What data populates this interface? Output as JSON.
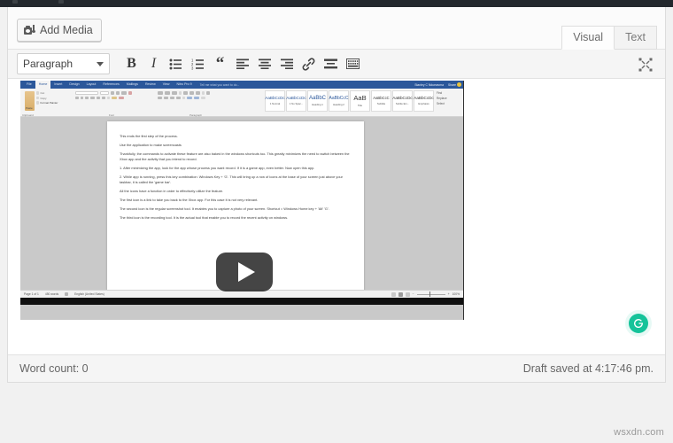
{
  "admin_bar": {
    "present": true
  },
  "media_row": {
    "add_media_label": "Add Media",
    "view_tabs": [
      {
        "label": "Visual",
        "active": true
      },
      {
        "label": "Text",
        "active": false
      }
    ]
  },
  "toolbar": {
    "format_select_value": "Paragraph",
    "buttons": [
      {
        "name": "bold",
        "label": "B"
      },
      {
        "name": "italic",
        "label": "I"
      },
      {
        "name": "bulleted-list",
        "label": ""
      },
      {
        "name": "numbered-list",
        "label": ""
      },
      {
        "name": "blockquote",
        "label": "“"
      },
      {
        "name": "align-left",
        "label": ""
      },
      {
        "name": "align-center",
        "label": ""
      },
      {
        "name": "align-right",
        "label": ""
      },
      {
        "name": "insert-link",
        "label": ""
      },
      {
        "name": "read-more",
        "label": ""
      },
      {
        "name": "toolbar-toggle",
        "label": ""
      }
    ],
    "expand_label": "Distraction-free writing mode"
  },
  "video_embed": {
    "word_app": {
      "ribbon_tabs": [
        "File",
        "Home",
        "Insert",
        "Design",
        "Layout",
        "References",
        "Mailings",
        "Review",
        "View",
        "Nitro Pro 9"
      ],
      "active_tab": "Home",
      "tell_me": "Tell me what you want to do...",
      "account_name": "Stanley C Nduewuma",
      "share_label": "Share",
      "clipboard_group": {
        "label": "Clipboard",
        "items": [
          "Cut",
          "Copy",
          "Format Painter",
          "Paste"
        ]
      },
      "font_group": {
        "label": "Font",
        "font_name": "Calibri (Body)",
        "font_size": "11"
      },
      "paragraph_group": {
        "label": "Paragraph"
      },
      "styles_group": {
        "label": "Styles",
        "items": [
          {
            "preview": "AaBbCcDc",
            "name": "1 Normal"
          },
          {
            "preview": "AaBbCcDc",
            "name": "1 No Spac..."
          },
          {
            "preview": "AaBbC",
            "name": "Heading 1"
          },
          {
            "preview": "AaBbCcC",
            "name": "Heading 2"
          },
          {
            "preview": "AaB",
            "name": "Title"
          },
          {
            "preview": "AaBbCcC",
            "name": "Subtitle"
          },
          {
            "preview": "AaBbCcDc",
            "name": "Subtle Em..."
          },
          {
            "preview": "AaBbCcDc",
            "name": "Emphasis"
          }
        ]
      },
      "editing_group": {
        "label": "Editing",
        "items": [
          "Find",
          "Replace",
          "Select"
        ]
      },
      "document_lines": [
        "This ends the first step of the process.",
        "Use the application to make screencasts",
        "Thankfully, the commands to activate these feature are also baked in the windows shortcuts too. This greatly minimizes the need to switch between the Xbox app and the activity that you intend to record.",
        "1. After minimizing the app, look for the app whose process you want record. If it is a game app, even better. Now open this app.",
        "2. While app is running, press this key combination: Windows Key + 'G'. This will bring up a row of icons at the base of your screen just above your taskbar, it is called the 'game bar'.",
        "All the icons have a function in order to effectively utilize the feature.",
        "The first icon is a link to take you back to the Xbox app. For this case it is not very relevant.",
        "The second icon is the regular screenshot tool. It enables you to capture a photo of your screen. Shortcut = Windows Home key + 'Alt' 'G'.",
        "The third icon is the recording tool. It is the actual tool that enable you to record the recent activity on windows."
      ],
      "status_bar": {
        "page": "Page 1 of 1",
        "words": "450 words",
        "language": "English (United States)",
        "zoom": "100%"
      }
    },
    "play_button_label": "Play"
  },
  "grammarly": {
    "name": "Grammarly",
    "color": "#15c39a"
  },
  "status_footer": {
    "word_count": "Word count: 0",
    "draft_saved": "Draft saved at 4:17:46 pm."
  },
  "watermark": {
    "text": "wsxdn.com"
  },
  "colors": {
    "page_background": "#f1f1f1",
    "admin_bar": "#23282d",
    "word_ribbon_blue": "#2b579a",
    "grammarly_green": "#15c39a"
  }
}
